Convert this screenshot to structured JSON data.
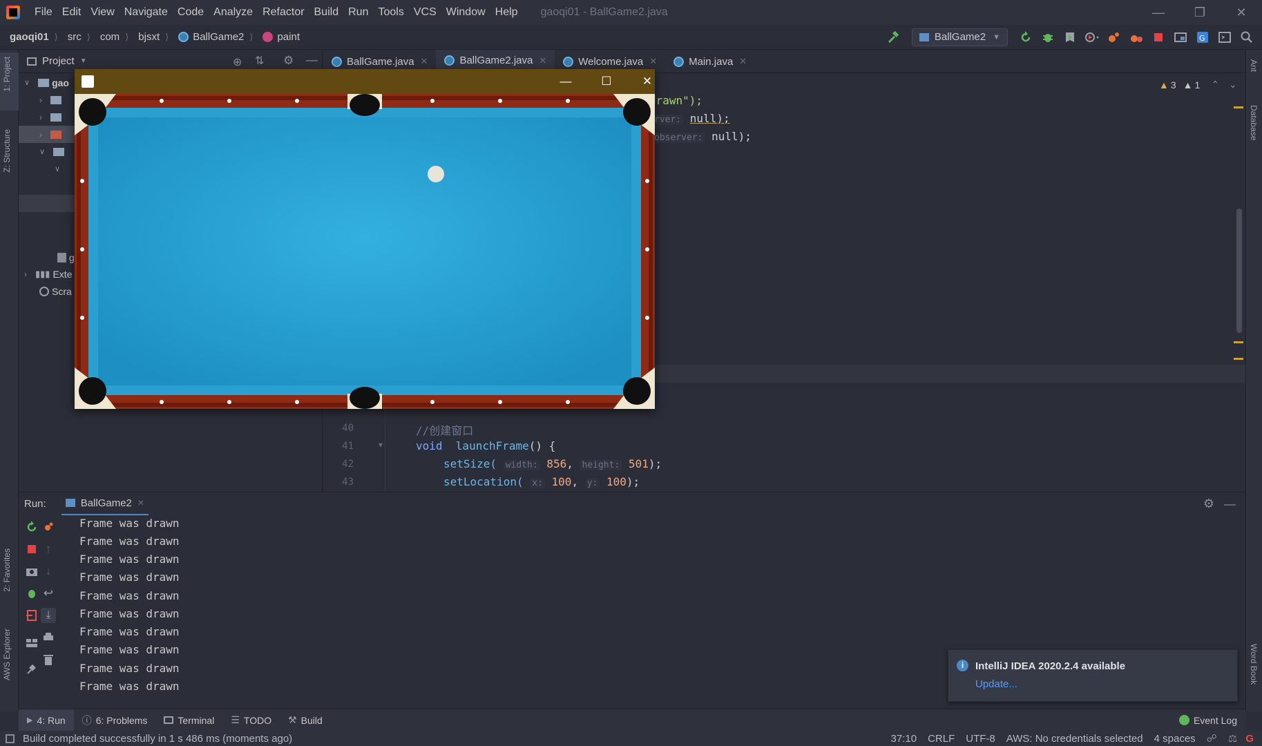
{
  "app": {
    "window_title": "gaoqi01 - BallGame2.java",
    "menu": [
      "File",
      "Edit",
      "View",
      "Navigate",
      "Code",
      "Analyze",
      "Refactor",
      "Build",
      "Run",
      "Tools",
      "VCS",
      "Window",
      "Help"
    ]
  },
  "breadcrumb": {
    "project": "gaoqi01",
    "items": [
      "src",
      "com",
      "bjsxt"
    ],
    "class": "BallGame2",
    "method": "paint"
  },
  "toolbar": {
    "run_config": "BallGame2"
  },
  "left_strip": {
    "project_tab": "1: Project",
    "structure_tab": "Z: Structure",
    "favorites_tab": "2: Favorites",
    "aws_tab": "AWS Explorer"
  },
  "right_strip": {
    "ant_tab": "Ant",
    "database_tab": "Database",
    "wordbook_tab": "Word Book"
  },
  "project_panel": {
    "title": "Project",
    "tree": {
      "root": "gao",
      "external": "Exte",
      "scratches": "Scra",
      "partial": "g"
    }
  },
  "editor": {
    "tabs": [
      {
        "label": "BallGame.java"
      },
      {
        "label": "BallGame2.java"
      },
      {
        "label": "Welcome.java"
      },
      {
        "label": "Main.java"
      }
    ],
    "inspections": {
      "warnings": "3",
      "weak_warnings": "1"
    },
    "code_fragments": {
      "line_a": "drawn\");",
      "line_b_hint": "rver:",
      "line_b": "null);",
      "line_c_hint": "observer:",
      "line_c": "null);"
    },
    "lines": [
      {
        "num": "40",
        "comment": "//创建窗口"
      },
      {
        "num": "41",
        "keyword": "void",
        "name": "launchFrame",
        "rest": "() {"
      },
      {
        "num": "42",
        "call": "setSize(",
        "hint1": "width:",
        "val1": "856",
        "hint2": "height:",
        "val2": "501",
        "end": ");"
      },
      {
        "num": "43",
        "call": "setLocation(",
        "hint1": "x:",
        "val1": "100",
        "hint2": "y:",
        "val2": "100",
        "end": ");"
      }
    ]
  },
  "run_panel": {
    "label": "Run:",
    "tab": "BallGame2",
    "output": [
      "Frame was drawn",
      "Frame was drawn",
      "Frame was drawn",
      "Frame was drawn",
      "Frame was drawn",
      "Frame was drawn",
      "Frame was drawn",
      "Frame was drawn",
      "Frame was drawn",
      "Frame was drawn"
    ]
  },
  "notification": {
    "title": "IntelliJ IDEA 2020.2.4 available",
    "link": "Update..."
  },
  "tool_tabs": [
    {
      "label": "4: Run"
    },
    {
      "label": "6: Problems"
    },
    {
      "label": "Terminal"
    },
    {
      "label": "TODO"
    },
    {
      "label": "Build"
    }
  ],
  "event_log": "Event Log",
  "status": {
    "message": "Build completed successfully in 1 s 486 ms (moments ago)",
    "position": "37:10",
    "line_sep": "CRLF",
    "encoding": "UTF-8",
    "aws": "AWS: No credentials selected",
    "indent": "4 spaces"
  },
  "colors": {
    "accent": "#4a88c7",
    "felt": "#2aa3d4",
    "rail": "#9c2a12",
    "game_titlebar": "#624911"
  }
}
